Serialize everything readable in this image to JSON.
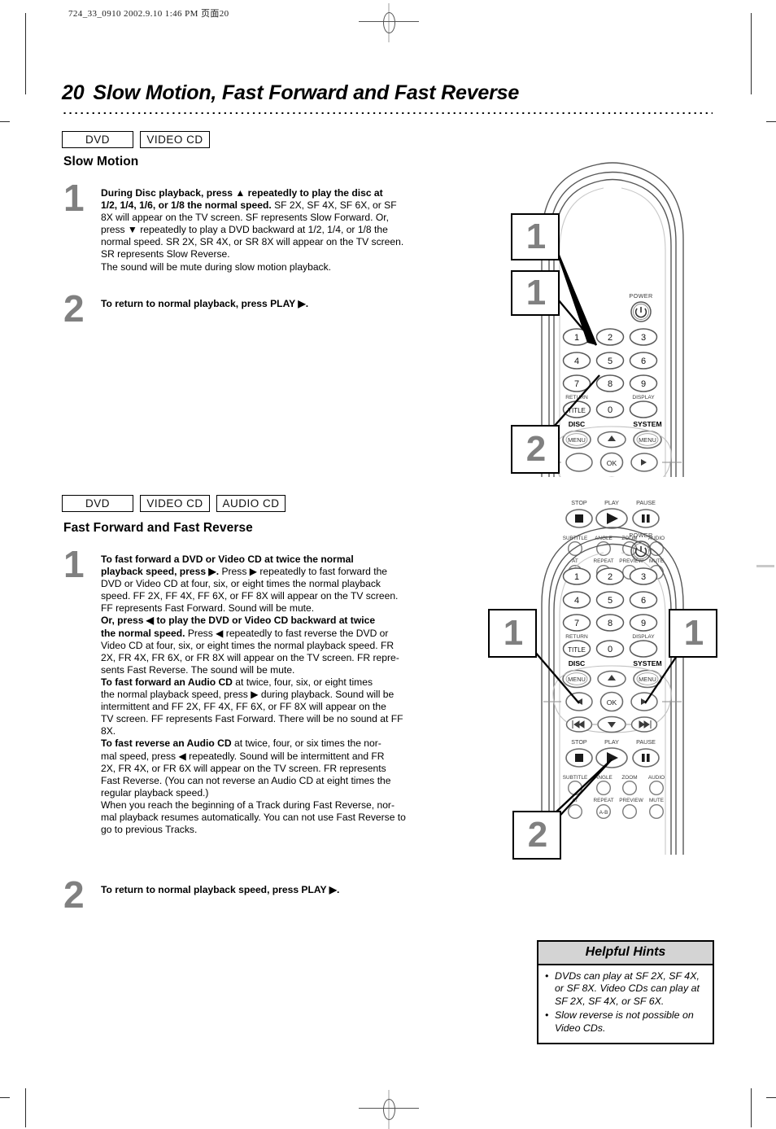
{
  "print_header": "724_33_0910   2002.9.10 1:46 PM  页面20",
  "page": {
    "number": "20",
    "title": "Slow Motion, Fast Forward and Fast Reverse"
  },
  "section_slow_motion": {
    "badges": [
      "DVD",
      "VIDEO CD"
    ],
    "heading": "Slow Motion",
    "steps": [
      {
        "number": "1",
        "lines": [
          {
            "bold": "During Disc playback, press ▲ repeatedly to play the disc at"
          },
          {
            "bold": "1/2, 1/4, 1/6, or 1/8 the normal speed.",
            "plain": " SF 2X, SF 4X, SF 6X, or SF"
          },
          {
            "plain": "8X will appear on the TV screen. SF represents Slow Forward. Or,"
          },
          {
            "plain": "press ▼ repeatedly to play a DVD backward at 1/2, 1/4, or 1/8 the"
          },
          {
            "plain": "normal speed. SR 2X, SR 4X, or SR 8X will appear on the TV screen."
          },
          {
            "plain": "SR represents Slow Reverse."
          },
          {
            "plain": "The sound will be mute during slow motion playback."
          }
        ]
      },
      {
        "number": "2",
        "lines": [
          {
            "bold": "To return to normal playback, press PLAY ▶."
          }
        ]
      }
    ]
  },
  "section_fast": {
    "badges": [
      "DVD",
      "VIDEO CD",
      "AUDIO CD"
    ],
    "heading": "Fast Forward and Fast Reverse",
    "steps": [
      {
        "number": "1",
        "lines": [
          {
            "bold": "To fast forward a DVD or Video CD at twice the normal"
          },
          {
            "bold": "playback speed, press ▶.",
            "plain": " Press ▶ repeatedly to fast forward the"
          },
          {
            "plain": "DVD or Video CD at four, six, or eight times the normal playback"
          },
          {
            "plain": "speed. FF 2X, FF 4X, FF 6X, or FF 8X will appear on the TV screen."
          },
          {
            "plain": "FF represents Fast Forward. Sound will be mute."
          },
          {
            "bold": "Or, press ◀ to play the DVD or Video CD backward at twice"
          },
          {
            "bold": "the normal speed.",
            "plain": " Press ◀ repeatedly to fast reverse the DVD or"
          },
          {
            "plain": "Video CD at four, six, or eight times the normal playback speed. FR"
          },
          {
            "plain": "2X, FR 4X, FR 6X, or FR 8X will appear on the TV screen. FR repre-"
          },
          {
            "plain": "sents Fast Reverse. The sound will be mute."
          },
          {
            "bold": "To fast forward an Audio CD",
            "plain": " at twice, four, six, or eight times"
          },
          {
            "plain": "the normal playback speed, press ▶ during playback. Sound will be"
          },
          {
            "plain": "intermittent and FF 2X, FF 4X, FF 6X, or FF 8X will appear on the"
          },
          {
            "plain": "TV screen. FF represents Fast Forward. There will be no sound at FF"
          },
          {
            "plain": "8X."
          },
          {
            "bold": "To fast reverse an Audio CD",
            "plain": " at twice, four, or six times the nor-"
          },
          {
            "plain": "mal speed, press ◀ repeatedly. Sound will be intermittent and FR"
          },
          {
            "plain": "2X, FR 4X, or FR 6X will appear on the TV screen. FR represents"
          },
          {
            "plain": "Fast Reverse. (You can not reverse an Audio CD at eight times the"
          },
          {
            "plain": "regular playback speed.)"
          },
          {
            "plain": "When you reach the beginning of a Track during Fast Reverse, nor-"
          },
          {
            "plain": "mal playback resumes automatically. You can not use Fast Reverse to"
          },
          {
            "plain": "go to previous Tracks."
          }
        ]
      },
      {
        "number": "2",
        "lines": [
          {
            "bold": "To return to normal playback speed, press PLAY ▶."
          }
        ]
      }
    ]
  },
  "helpful_hints": {
    "title": "Helpful Hints",
    "items": [
      "DVDs can play at SF 2X, SF 4X, or SF 8X. Video CDs can play at SF 2X, SF 4X, or SF 6X.",
      "Slow reverse is not possible on Video CDs."
    ]
  },
  "remote_labels": {
    "power": "POWER",
    "keys": [
      "1",
      "2",
      "3",
      "4",
      "5",
      "6",
      "7",
      "8",
      "9"
    ],
    "zero": "0",
    "return": "RETURN",
    "title_key": "TITLE",
    "display": "DISPLAY",
    "disc": "DISC",
    "system": "SYSTEM",
    "menu": "MENU",
    "ok": "OK",
    "stop": "STOP",
    "play": "PLAY",
    "pause": "PAUSE",
    "subtitle": "SUBTITLE",
    "angle": "ANGLE",
    "zoom": "ZOOM",
    "audio": "AUDIO",
    "repeat_short": "AT",
    "repeat": "REPEAT",
    "preview": "PREVIEW",
    "mute": "MUTE",
    "ab": "A-B"
  },
  "callouts": {
    "remote1": [
      "1",
      "1",
      "2"
    ],
    "remote2": [
      "1",
      "1",
      "2"
    ]
  },
  "colors": {
    "step_number": "#808080",
    "hints_header_bg": "#d4d4d4",
    "ink": "#000000",
    "remote_line": "#4d4d4d"
  }
}
